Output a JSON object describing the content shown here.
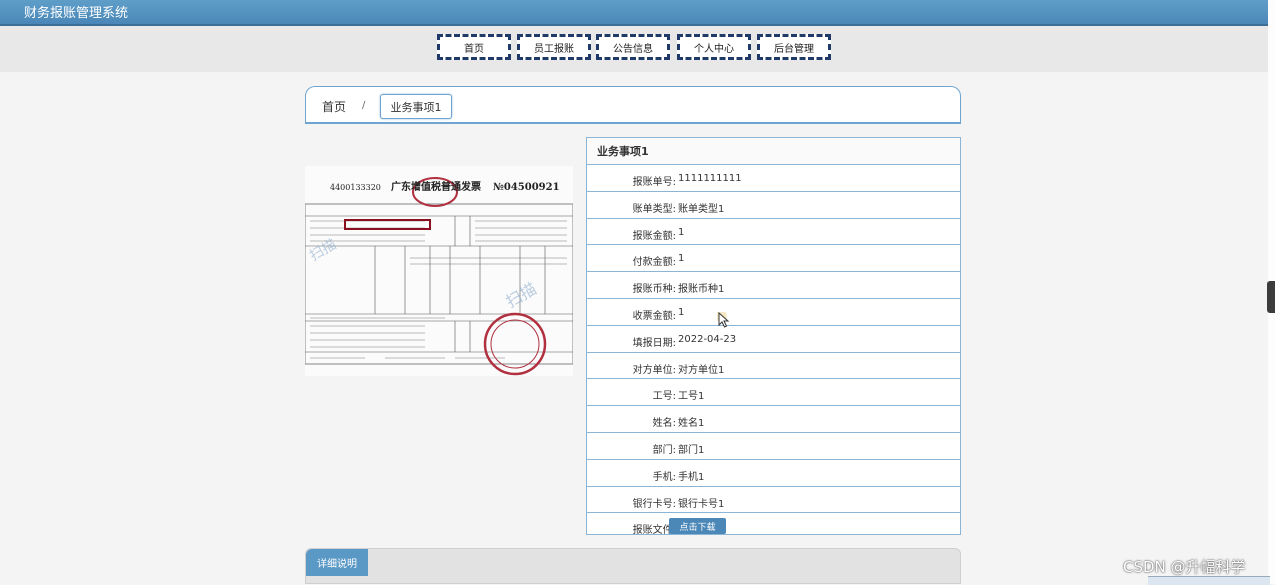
{
  "app": {
    "title": "财务报账管理系统"
  },
  "nav": {
    "items": [
      "首页",
      "员工报账",
      "公告信息",
      "个人中心",
      "后台管理"
    ]
  },
  "breadcrumb": {
    "home": "首页",
    "separator": "/",
    "current": "业务事项1"
  },
  "invoice": {
    "number": "4400133320",
    "title": "广东增值税普通发票",
    "code": "№04500921"
  },
  "detail": {
    "title": "业务事项1",
    "fields": [
      {
        "label": "报账单号:",
        "value": "1111111111"
      },
      {
        "label": "账单类型:",
        "value": "账单类型1"
      },
      {
        "label": "报账金额:",
        "value": "1"
      },
      {
        "label": "付款金额:",
        "value": "1"
      },
      {
        "label": "报账币种:",
        "value": "报账币种1"
      },
      {
        "label": "收票金额:",
        "value": "1"
      },
      {
        "label": "填报日期:",
        "value": "2022-04-23"
      },
      {
        "label": "对方单位:",
        "value": "对方单位1"
      },
      {
        "label": "工号:",
        "value": "工号1"
      },
      {
        "label": "姓名:",
        "value": "姓名1"
      },
      {
        "label": "部门:",
        "value": "部门1"
      },
      {
        "label": "手机:",
        "value": "手机1"
      },
      {
        "label": "银行卡号:",
        "value": "银行卡号1"
      }
    ],
    "file_label": "报账文件:",
    "download_label": "点击下载"
  },
  "description": {
    "tab_label": "详细说明"
  },
  "watermark": "CSDN @升幅科学",
  "colors": {
    "header": "#4a87b8",
    "border": "#8bb5d6",
    "nav_border": "#1f3a68",
    "button": "#4b88b8",
    "stamp": "#b03040"
  }
}
